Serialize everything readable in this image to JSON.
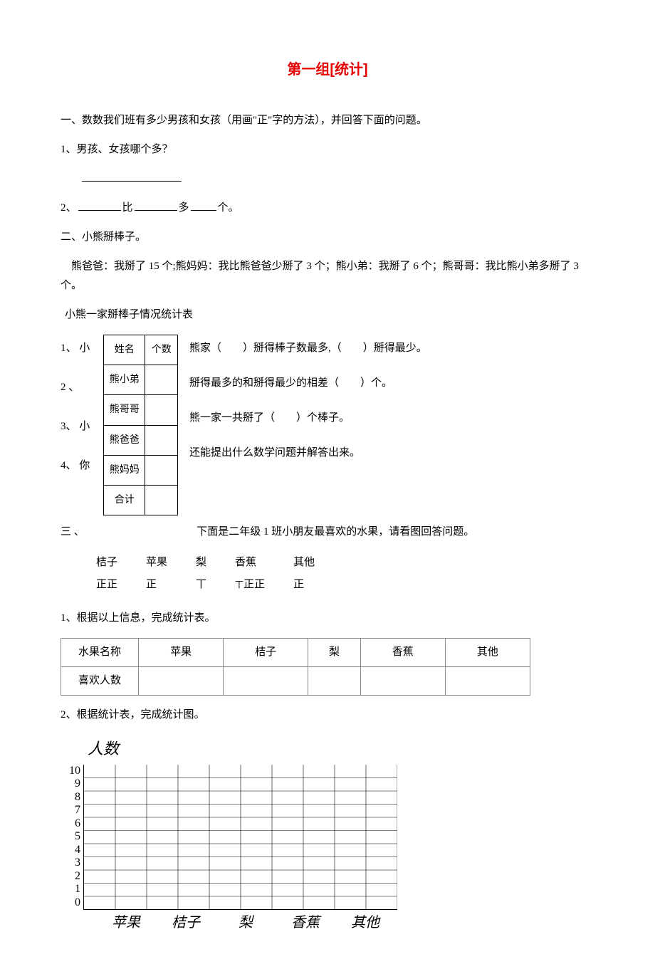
{
  "title": "第一组[统计]",
  "section1": {
    "heading": "一、数数我们班有多少男孩和女孩（用画\"正\"字的方法），并回答下面的问题。",
    "q1": "1、男孩、女孩哪个多？",
    "q2_prefix": "2、",
    "q2_mid1": "比",
    "q2_mid2": "多",
    "q2_suffix": "个。"
  },
  "section2": {
    "heading": "二、小熊掰棒子。",
    "story": "熊爸爸：我掰了 15 个;熊妈妈：我比熊爸爸少掰了 3 个；熊小弟：我掰了 6 个；熊哥哥：我比熊小弟多掰了 3 个。",
    "table_caption": "小熊一家掰棒子情况统计表",
    "nums": [
      "1、 小",
      "2 、",
      "3、 小",
      "4、 你"
    ],
    "table_header": [
      "姓名",
      "个数"
    ],
    "table_rows": [
      "熊小弟",
      "熊哥哥",
      "熊爸爸",
      "熊妈妈",
      "合计"
    ],
    "right_lines": [
      "熊家（　　）掰得棒子数最多,（　　）掰得最少。",
      "掰得最多的和掰得最少的相差（　　）个。",
      "熊一家一共掰了（　　）个棒子。",
      "还能提出什么数学问题并解答出来。"
    ]
  },
  "section3": {
    "heading_prefix": "三 、",
    "heading_text": "下面是二年级 1 班小朋友最喜欢的水果，请看图回答问题。",
    "tally_header": [
      "桔子",
      "苹果",
      "梨",
      "香蕉",
      "其他"
    ],
    "tally_marks": [
      "正正",
      "正",
      "丅",
      "正正",
      "正"
    ],
    "tally_extra": "丅",
    "q1": "1、根据以上信息，完成统计表。",
    "stat_header": [
      "水果名称",
      "苹果",
      "桔子",
      "梨",
      "香蕉",
      "其他"
    ],
    "stat_row_label": "喜欢人数",
    "q2": "2、根据统计表，完成统计图。"
  },
  "chart_data": {
    "type": "bar",
    "title": "",
    "ylabel": "人数",
    "xlabel": "",
    "categories": [
      "苹果",
      "桔子",
      "梨",
      "香蕉",
      "其他"
    ],
    "y_ticks": [
      0,
      1,
      2,
      3,
      4,
      5,
      6,
      7,
      8,
      9,
      10
    ],
    "ylim": [
      0,
      10
    ],
    "series": [
      {
        "name": "喜欢人数",
        "values": [
          null,
          null,
          null,
          null,
          null
        ]
      }
    ],
    "note": "blank grid to be filled in by student"
  }
}
